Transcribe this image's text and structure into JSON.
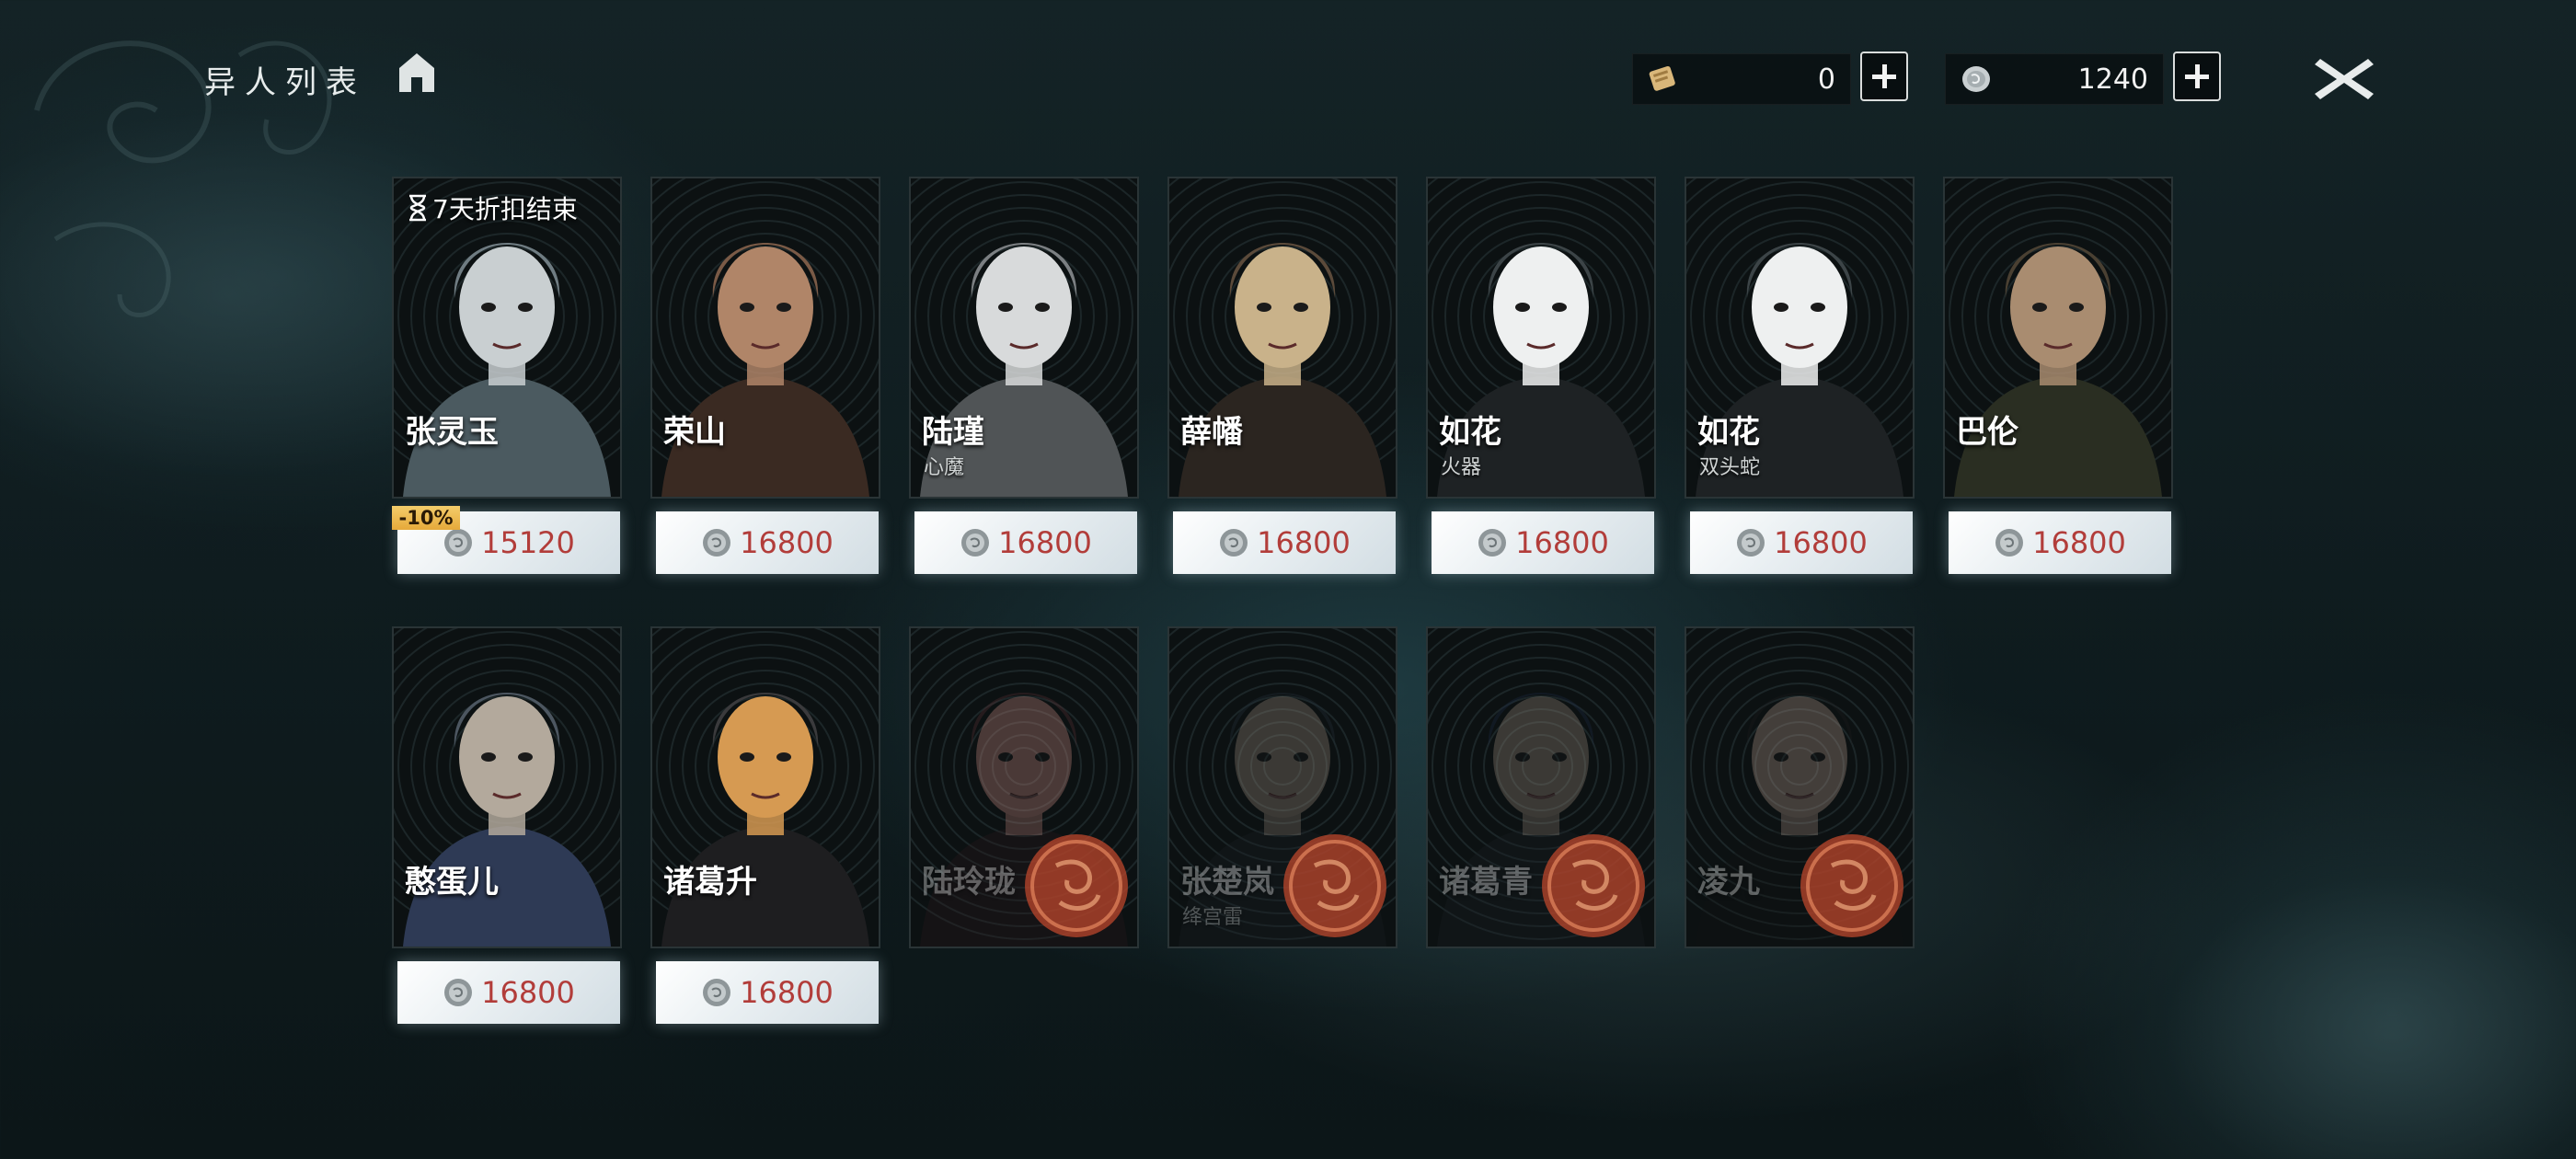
{
  "header": {
    "title": "异人列表",
    "currencies": [
      {
        "icon": "scroll-token-icon",
        "value": "0"
      },
      {
        "icon": "silver-coin-icon",
        "value": "1240"
      }
    ]
  },
  "discount": {
    "timer_text": "7天折扣结束",
    "badge": "-10%"
  },
  "characters": [
    {
      "name": "张灵玉",
      "sub": "",
      "price": "15120",
      "locked": false
    },
    {
      "name": "荣山",
      "sub": "",
      "price": "16800",
      "locked": false
    },
    {
      "name": "陆瑾",
      "sub": "心魔",
      "price": "16800",
      "locked": false
    },
    {
      "name": "薛幡",
      "sub": "",
      "price": "16800",
      "locked": false
    },
    {
      "name": "如花",
      "sub": "火器",
      "price": "16800",
      "locked": false
    },
    {
      "name": "如花",
      "sub": "双头蛇",
      "price": "16800",
      "locked": false
    },
    {
      "name": "巴伦",
      "sub": "",
      "price": "16800",
      "locked": false
    },
    {
      "name": "憨蛋儿",
      "sub": "",
      "price": "16800",
      "locked": false
    },
    {
      "name": "诸葛升",
      "sub": "",
      "price": "16800",
      "locked": false
    },
    {
      "name": "陆玲珑",
      "sub": "",
      "price": "",
      "locked": true
    },
    {
      "name": "张楚岚",
      "sub": "绛宫雷",
      "price": "",
      "locked": true
    },
    {
      "name": "诸葛青",
      "sub": "",
      "price": "",
      "locked": true
    },
    {
      "name": "凌九",
      "sub": "",
      "price": "",
      "locked": true
    }
  ],
  "colors": {
    "price_text": "#b23d3a",
    "badge": "#f0c060",
    "stamp": "#c8452a"
  }
}
